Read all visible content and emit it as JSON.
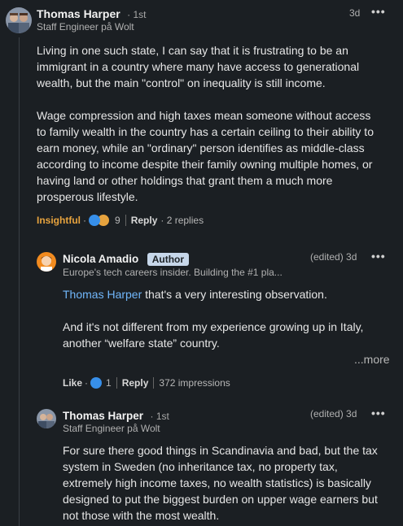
{
  "comments": [
    {
      "author": "Thomas Harper",
      "degree": "· 1st",
      "headline": "Staff Engineer på Wolt",
      "time": "3d",
      "paragraphs": [
        "Living in one such state, I can say that it is frustrating to be an immigrant in a country where many have access to generational wealth, but the main \"control\" on inequality is still income.",
        "Wage compression and high taxes mean someone without access to family wealth in the country has a certain ceiling to their ability to earn money, while an \"ordinary\" person identifies as middle-class according to income despite their family owning multiple homes, or having land or other holdings that grant them a much more prosperous lifestyle."
      ],
      "reaction_label": "Insightful",
      "reaction_count": "9",
      "reply_label": "Reply",
      "replies_count": "· 2 replies"
    }
  ],
  "replies": [
    {
      "author": "Nicola Amadio",
      "badge": "Author",
      "headline": "Europe's tech careers insider. Building the #1 pla...",
      "time": "(edited) 3d",
      "mention": "Thomas Harper",
      "paragraph1_rest": " that's a very interesting observation.",
      "paragraph2": "And it's not different from my experience growing up in Italy, another “welfare state” country.",
      "more_label": "...more",
      "like_label": "Like",
      "reaction_count": "1",
      "reply_label": "Reply",
      "impressions": "372 impressions"
    },
    {
      "author": "Thomas Harper",
      "degree": "· 1st",
      "headline": "Staff Engineer på Wolt",
      "time": "(edited) 3d",
      "paragraph": "For sure there good things in Scandinavia and bad, but the tax system in Sweden (no inheritance tax, no property tax, extremely high income taxes, no wealth statistics) is basically designed to put the biggest burden on upper wage earners but not those with the most wealth."
    }
  ],
  "icons": {
    "more": "more-horizontal-icon",
    "like": "like-icon",
    "insightful": "lightbulb-icon"
  },
  "colors": {
    "background": "#1b1f23",
    "link": "#71b7fb",
    "insightful": "#e7a33e",
    "badge_bg": "#c7d7ea"
  }
}
